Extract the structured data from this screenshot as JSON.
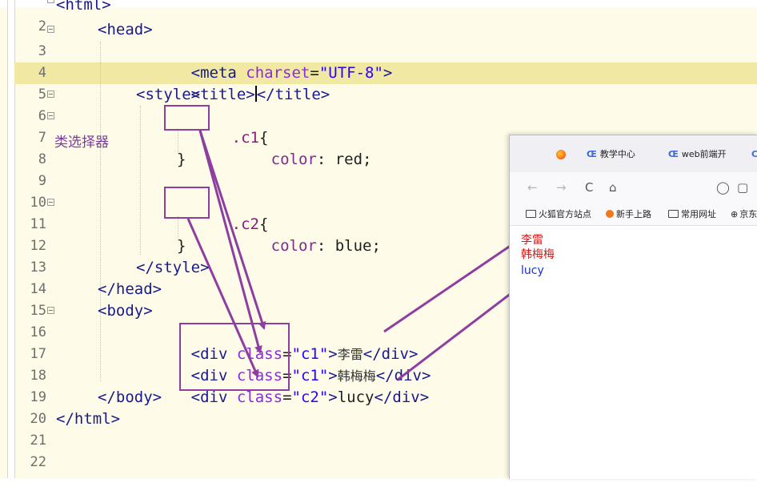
{
  "editor": {
    "lines": [
      {
        "n": "2",
        "fold": true
      },
      {
        "n": "3",
        "fold": true
      },
      {
        "n": "4",
        "fold": false
      },
      {
        "n": "5",
        "fold": false
      },
      {
        "n": "6",
        "fold": true
      },
      {
        "n": "7",
        "fold": true
      },
      {
        "n": "8",
        "fold": false
      },
      {
        "n": "9",
        "fold": false
      },
      {
        "n": "10",
        "fold": false
      },
      {
        "n": "11",
        "fold": true
      },
      {
        "n": "12",
        "fold": false
      },
      {
        "n": "13",
        "fold": false
      },
      {
        "n": "14",
        "fold": false
      },
      {
        "n": "15",
        "fold": false
      },
      {
        "n": "16",
        "fold": true
      },
      {
        "n": "17",
        "fold": false
      },
      {
        "n": "18",
        "fold": false
      },
      {
        "n": "19",
        "fold": false
      },
      {
        "n": "20",
        "fold": false
      },
      {
        "n": "21",
        "fold": false
      },
      {
        "n": "22",
        "fold": false
      }
    ],
    "code": {
      "l2": "<html>",
      "l3": "<head>",
      "l4_tag": "<meta",
      "l4_attr": "charset",
      "l4_eq": "=",
      "l4_val": "\"UTF-8\"",
      "l4_end": ">",
      "l5_open": "<title>",
      "l5_close": "</title>",
      "l6": "<style>",
      "l7_sel": ".c1",
      "l7_brace": "{",
      "l8_prop": "color",
      "l8_val": ": red;",
      "l9": "}",
      "l11_sel": ".c2",
      "l11_brace": "{",
      "l12_prop": "color",
      "l12_val": ": blue;",
      "l13": "}",
      "l14": "</style>",
      "l15": "</head>",
      "l16": "<body>",
      "div_open": "<div",
      "class_attr": "class",
      "eq": "=",
      "c1_val": "\"c1\"",
      "c2_val": "\"c2\"",
      "gt": ">",
      "l17_text": "李雷",
      "l18_text": "韩梅梅",
      "l19_text": "lucy",
      "div_close": "</div>",
      "l20": "</body>",
      "l21": "</html>"
    },
    "annotation": "类选择器",
    "colors": {
      "annotation": "#7c3aa0",
      "highlight_box": "#8e3ea1",
      "current_line": "#f0e8a3"
    }
  },
  "browser": {
    "tabs": [
      {
        "icon": "firefox-icon",
        "label": ""
      },
      {
        "icon": "cc-icon",
        "label": "教学中心"
      },
      {
        "icon": "cc-icon",
        "label": "web前端开"
      }
    ],
    "nav": {
      "back": "←",
      "forward": "→",
      "reload": "C",
      "home": "⌂",
      "shield": "◯",
      "page": "▢"
    },
    "bookmarks": [
      {
        "icon": "folder-icon",
        "label": "火狐官方站点"
      },
      {
        "icon": "firefox-icon",
        "label": "新手上路"
      },
      {
        "icon": "folder-icon",
        "label": "常用网址"
      },
      {
        "icon": "globe-icon",
        "label": "京东"
      }
    ],
    "output": [
      {
        "text": "李雷",
        "color": "#d11a1a"
      },
      {
        "text": "韩梅梅",
        "color": "#d11a1a"
      },
      {
        "text": "lucy",
        "color": "#1a2fd1"
      }
    ]
  }
}
